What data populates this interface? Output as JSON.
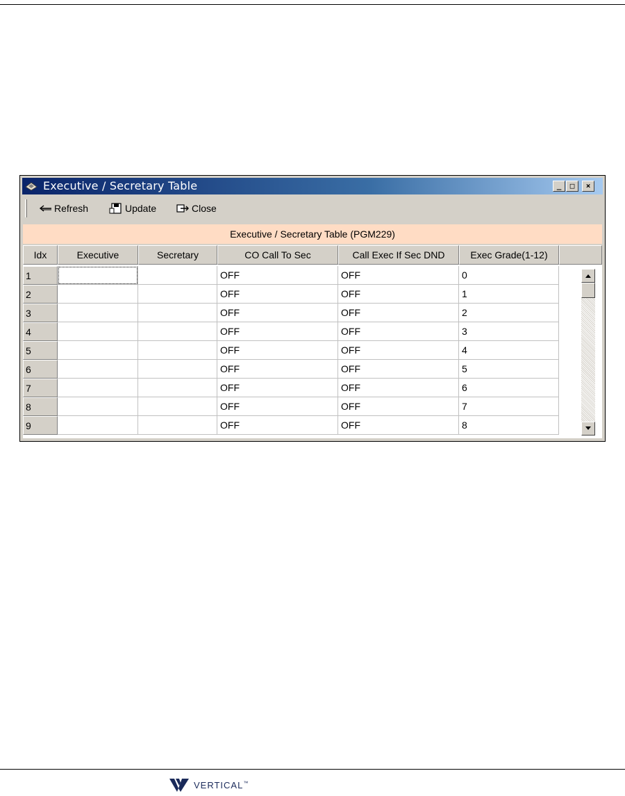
{
  "window": {
    "title": "Executive / Secretary Table",
    "controls": {
      "minimize": "_",
      "maximize": "□",
      "close": "×"
    }
  },
  "toolbar": {
    "refresh_label": "Refresh",
    "update_label": "Update",
    "close_label": "Close"
  },
  "banner": "Executive / Secretary Table (PGM229)",
  "table": {
    "columns": [
      "Idx",
      "Executive",
      "Secretary",
      "CO Call To Sec",
      "Call Exec If Sec DND",
      "Exec Grade(1-12)"
    ],
    "rows": [
      {
        "idx": "1",
        "executive": "",
        "secretary": "",
        "co_call": "OFF",
        "call_exec": "OFF",
        "grade": "0"
      },
      {
        "idx": "2",
        "executive": "",
        "secretary": "",
        "co_call": "OFF",
        "call_exec": "OFF",
        "grade": "1"
      },
      {
        "idx": "3",
        "executive": "",
        "secretary": "",
        "co_call": "OFF",
        "call_exec": "OFF",
        "grade": "2"
      },
      {
        "idx": "4",
        "executive": "",
        "secretary": "",
        "co_call": "OFF",
        "call_exec": "OFF",
        "grade": "3"
      },
      {
        "idx": "5",
        "executive": "",
        "secretary": "",
        "co_call": "OFF",
        "call_exec": "OFF",
        "grade": "4"
      },
      {
        "idx": "6",
        "executive": "",
        "secretary": "",
        "co_call": "OFF",
        "call_exec": "OFF",
        "grade": "5"
      },
      {
        "idx": "7",
        "executive": "",
        "secretary": "",
        "co_call": "OFF",
        "call_exec": "OFF",
        "grade": "6"
      },
      {
        "idx": "8",
        "executive": "",
        "secretary": "",
        "co_call": "OFF",
        "call_exec": "OFF",
        "grade": "7"
      },
      {
        "idx": "9",
        "executive": "",
        "secretary": "",
        "co_call": "OFF",
        "call_exec": "OFF",
        "grade": "8"
      }
    ]
  },
  "footer": {
    "logo_text": "VERTICAL",
    "logo_tm": "™"
  },
  "colors": {
    "titlebar": "#0a246a",
    "banner": "#ffdcc4",
    "chrome": "#d4d0c8",
    "logo": "#1a2a5a"
  },
  "icons": [
    "app-icon",
    "refresh-arrow-icon",
    "update-disk-icon",
    "close-door-icon",
    "scroll-up-icon",
    "scroll-down-icon",
    "vertical-logo-icon"
  ]
}
